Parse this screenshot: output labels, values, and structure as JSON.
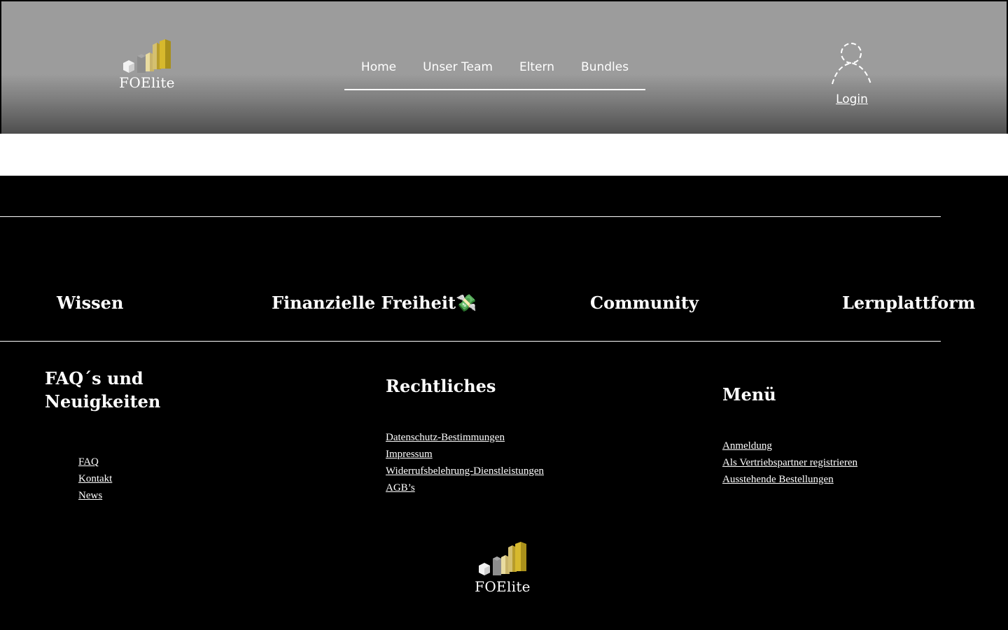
{
  "header": {
    "logo_text": "FOElite",
    "nav": [
      "Home",
      "Unser Team",
      "Eltern",
      "Bundles"
    ],
    "login_label": "Login"
  },
  "categories": [
    "Wissen",
    "Finanzielle Freiheit💸",
    "Community",
    "Lernplattform"
  ],
  "footer": {
    "col1": {
      "title_line1": "FAQ´s und",
      "title_line2": "Neuigkeiten",
      "links": [
        "FAQ",
        "Kontakt",
        "News"
      ]
    },
    "col2": {
      "title": "Rechtliches",
      "links": [
        "Datenschutz-Bestimmungen",
        "Impressum",
        "Widerrufsbelehrung-Dienstleistungen",
        "AGB’s"
      ]
    },
    "col3": {
      "title": "Menü",
      "links": [
        "Anmeldung",
        "Als Vertriebspartner registrieren",
        "Ausstehende Bestellungen"
      ]
    },
    "logo_text": "FOElite"
  },
  "colors": {
    "header_gray": "#9c9c9c",
    "gold": "#d4b52c",
    "background": "#000000"
  }
}
